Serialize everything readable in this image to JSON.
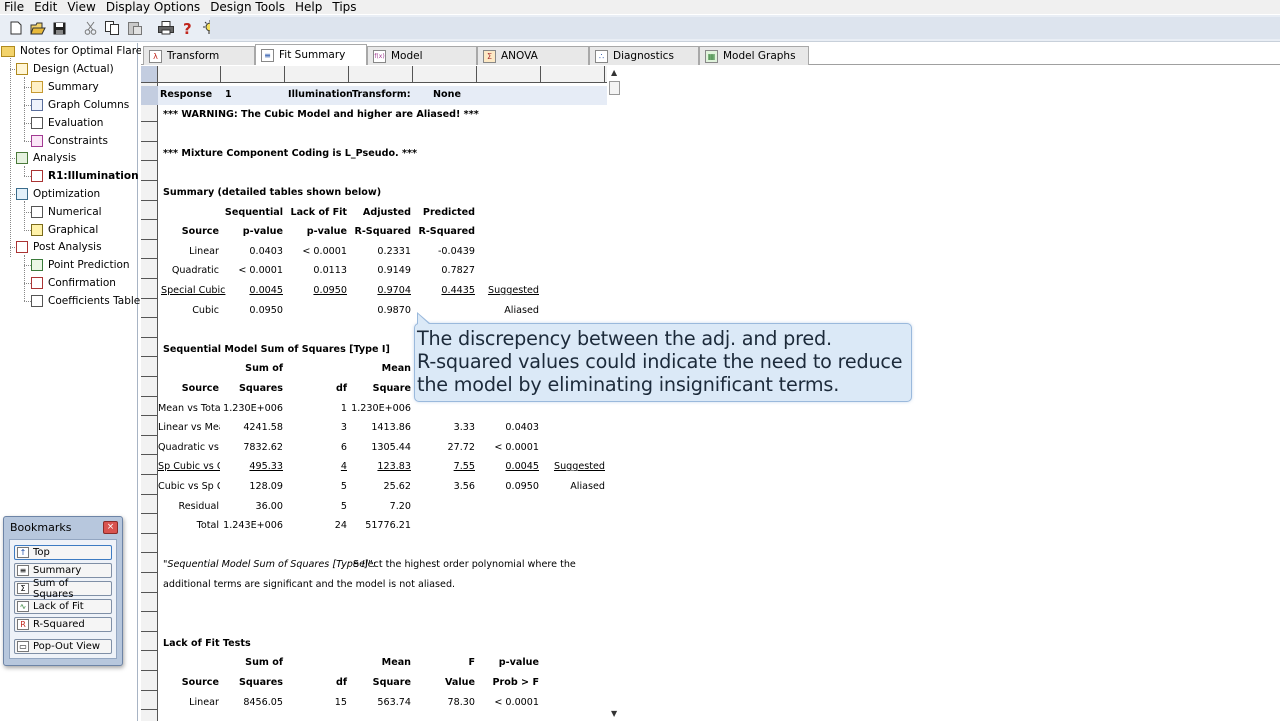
{
  "menu": [
    "File",
    "Edit",
    "View",
    "Display Options",
    "Design Tools",
    "Help",
    "Tips"
  ],
  "toolbar": {
    "icons": [
      "new-file-icon",
      "open-folder-icon",
      "save-icon",
      "cut-icon",
      "copy-icon",
      "paste-icon",
      "print-icon",
      "help-icon",
      "tip-bulb-icon"
    ]
  },
  "tree": {
    "root": "Notes for Optimal Flare wit",
    "design": "Design (Actual)",
    "summary": "Summary",
    "graph_columns": "Graph Columns",
    "evaluation": "Evaluation",
    "constraints": "Constraints",
    "analysis": "Analysis",
    "r1": "R1:Illumination",
    "optimization": "Optimization",
    "numerical": "Numerical",
    "graphical": "Graphical",
    "post_analysis": "Post Analysis",
    "point_prediction": "Point Prediction",
    "confirmation": "Confirmation",
    "coefficients_table": "Coefficients Table"
  },
  "bookmarks": {
    "title": "Bookmarks",
    "close": "×",
    "items": [
      {
        "label": "Top",
        "icon": "↑"
      },
      {
        "label": "Summary",
        "icon": "≡"
      },
      {
        "label": "Sum of Squares",
        "icon": "Σ"
      },
      {
        "label": "Lack of Fit",
        "icon": "∿"
      },
      {
        "label": "R-Squared",
        "icon": "R"
      },
      {
        "label": "Pop-Out View",
        "icon": "▭"
      }
    ]
  },
  "tabs": [
    {
      "label": "Transform",
      "icon": "λ"
    },
    {
      "label": "Fit Summary",
      "icon": "≡"
    },
    {
      "label": "Model",
      "icon": "f(x)"
    },
    {
      "label": "ANOVA",
      "icon": "Σ"
    },
    {
      "label": "Diagnostics",
      "icon": "∴"
    },
    {
      "label": "Model Graphs",
      "icon": "▦"
    }
  ],
  "report": {
    "response": {
      "label": "Response",
      "num": "1",
      "name": "Illumination",
      "transform_label": "Transform:",
      "transform": "None"
    },
    "warning": "*** WARNING:  The Cubic Model and higher are Aliased! ***",
    "coding": "*** Mixture Component Coding is L_Pseudo. ***",
    "summary_title": "Summary (detailed tables shown below)",
    "summary_header1": [
      "Sequential",
      "Lack of Fit",
      "Adjusted",
      "Predicted"
    ],
    "summary_header2": [
      "Source",
      "p-value",
      "p-value",
      "R-Squared",
      "R-Squared"
    ],
    "summary_rows": [
      [
        "Linear",
        "0.0403",
        "< 0.0001",
        "0.2331",
        "-0.0439",
        ""
      ],
      [
        "Quadratic",
        "< 0.0001",
        "0.0113",
        "0.9149",
        "0.7827",
        ""
      ],
      [
        "Special Cubic",
        "0.0045",
        "0.0950",
        "0.9704",
        "0.4435",
        "Suggested"
      ],
      [
        "Cubic",
        "0.0950",
        "",
        "0.9870",
        "",
        "Aliased"
      ]
    ],
    "seq_title": "Sequential Model Sum of Squares [Type I]",
    "seq_header1": [
      "Sum of",
      "Mean"
    ],
    "seq_header2": [
      "Source",
      "Squares",
      "df",
      "Square"
    ],
    "seq_rows": [
      [
        "Mean vs Total",
        "1.230E+006",
        "1",
        "1.230E+006",
        "",
        "",
        ""
      ],
      [
        "Linear vs Mear",
        "4241.58",
        "3",
        "1413.86",
        "3.33",
        "0.0403",
        ""
      ],
      [
        "Quadratic vs L",
        "7832.62",
        "6",
        "1305.44",
        "27.72",
        "< 0.0001",
        ""
      ],
      [
        "Sp Cubic vs Qu",
        "495.33",
        "4",
        "123.83",
        "7.55",
        "0.0045",
        "Suggested"
      ],
      [
        "Cubic vs Sp Cu",
        "128.09",
        "5",
        "25.62",
        "3.56",
        "0.0950",
        "Aliased"
      ],
      [
        "Residual",
        "36.00",
        "5",
        "7.20",
        "",
        "",
        ""
      ],
      [
        "Total",
        "1.243E+006",
        "24",
        "51776.21",
        "",
        "",
        ""
      ]
    ],
    "seq_note_1_italic": "\"Sequential Model Sum of Squares [Type I]\":",
    "seq_note_1_rest": "  Select the highest order polynomial where the",
    "seq_note_2": "additional terms are significant and the model is not aliased.",
    "lof_title": "Lack of Fit Tests",
    "lof_header1": [
      "Sum of",
      "Mean",
      "F",
      "p-value"
    ],
    "lof_header2": [
      "Source",
      "Squares",
      "df",
      "Square",
      "Value",
      "Prob > F"
    ],
    "lof_rows": [
      [
        "Linear",
        "8456.05",
        "15",
        "563.74",
        "78.30",
        "< 0.0001"
      ]
    ]
  },
  "callout": {
    "lines": [
      "The discrepency between the adj. and pred.",
      "R-squared values could indicate the need to reduce",
      "the model by eliminating insignificant terms."
    ]
  },
  "colors": {
    "toolbar_bg": "#e9eef5",
    "callout_bg": "#dbe9f7",
    "callout_border": "#9ab9dc",
    "bookmarks_bg": "#b7c7dd",
    "selection": "#c3cde0"
  }
}
